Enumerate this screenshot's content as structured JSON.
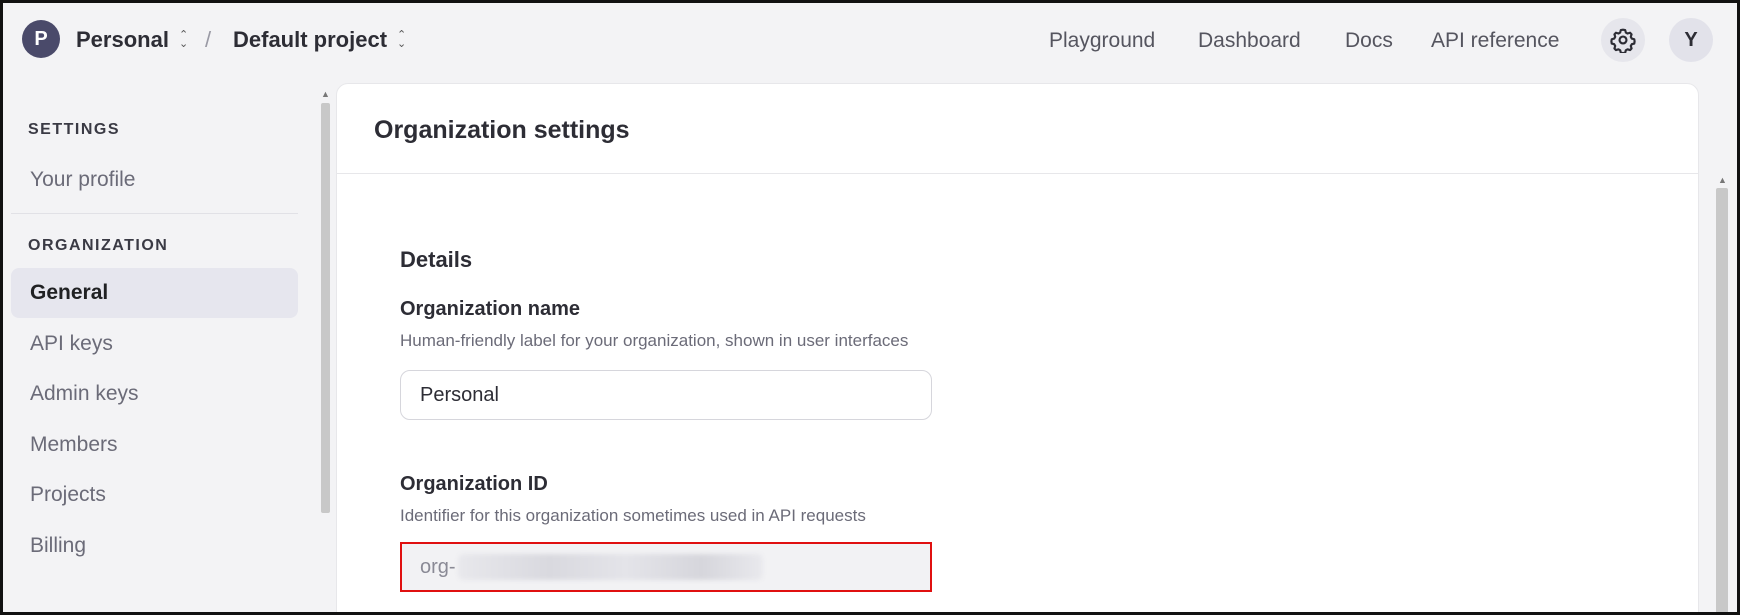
{
  "header": {
    "org_initial": "P",
    "org_name": "Personal",
    "separator": "/",
    "project_name": "Default project",
    "nav": {
      "playground": "Playground",
      "dashboard": "Dashboard",
      "docs": "Docs",
      "api_reference": "API reference"
    },
    "settings_icon": "gear-icon",
    "user_initial": "Y"
  },
  "sidebar": {
    "settings_heading": "SETTINGS",
    "your_profile": "Your profile",
    "organization_heading": "ORGANIZATION",
    "items": [
      {
        "label": "General",
        "active": true
      },
      {
        "label": "API keys",
        "active": false
      },
      {
        "label": "Admin keys",
        "active": false
      },
      {
        "label": "Members",
        "active": false
      },
      {
        "label": "Projects",
        "active": false
      },
      {
        "label": "Billing",
        "active": false
      }
    ]
  },
  "main": {
    "title": "Organization settings",
    "details_heading": "Details",
    "org_name_field": {
      "label": "Organization name",
      "help": "Human-friendly label for your organization, shown in user interfaces",
      "value": "Personal"
    },
    "org_id_field": {
      "label": "Organization ID",
      "help": "Identifier for this organization sometimes used in API requests",
      "value_prefix": "org-"
    }
  },
  "colors": {
    "highlight_border": "#e01010",
    "active_item_bg": "#e6e6ee",
    "org_avatar_bg": "#4a4a6a"
  }
}
